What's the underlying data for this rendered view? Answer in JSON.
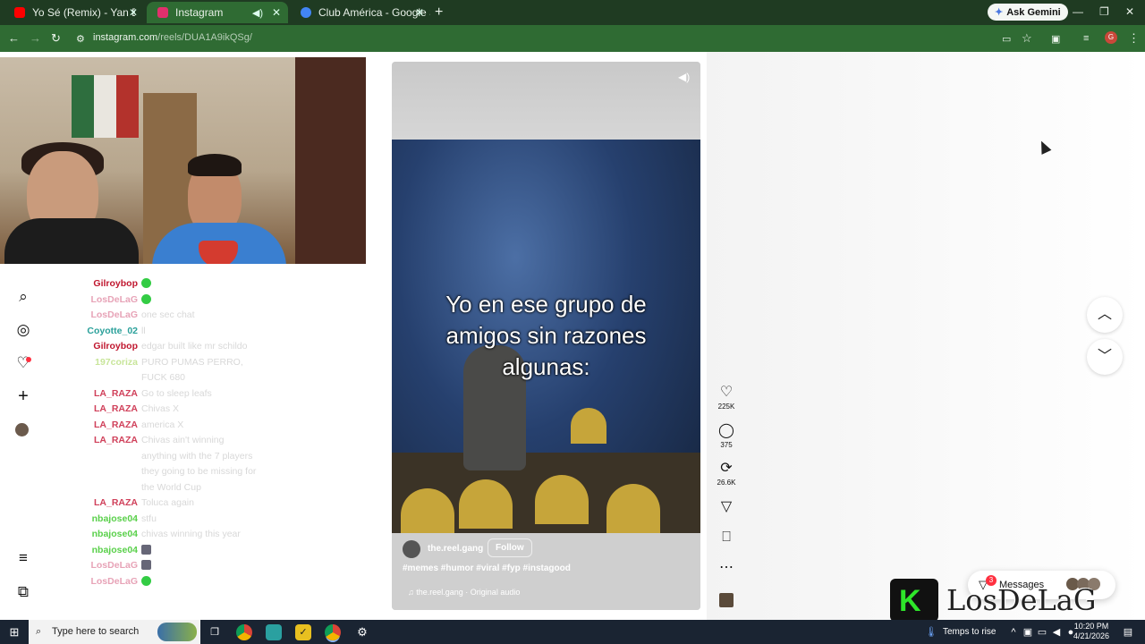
{
  "browser": {
    "tabs": [
      {
        "title": "Yo Sé (Remix) - Yan Block x Tor",
        "icon_color": "#ff0000",
        "active": false
      },
      {
        "title": "Instagram",
        "icon_color": "#e1306c",
        "active": true
      },
      {
        "title": "Club América - Google Search",
        "icon_color": "#4285f4",
        "active": false
      }
    ],
    "new_tab": "+",
    "ask_gemini": "Ask Gemini",
    "url_host": "instagram.com",
    "url_path": "/reels/DUA1A9ikQSg/",
    "profile_initial": "G",
    "colors": {
      "frame": "#1f3b22",
      "toolbar": "#2f6b33"
    }
  },
  "sidebar": {
    "icons": [
      "search-icon",
      "explore-icon",
      "heart-icon",
      "create-icon",
      "profile-icon",
      "menu-icon",
      "threads-icon"
    ]
  },
  "chat": {
    "messages": [
      {
        "user": "Gilroybop",
        "text": "",
        "color": "#c0172f",
        "emote": "green"
      },
      {
        "user": "LosDeLaG",
        "text": "",
        "color": "#e7a3b7",
        "emote": "green"
      },
      {
        "user": "LosDeLaG",
        "text": "one sec chat",
        "color": "#e7a3b7",
        "emote": ""
      },
      {
        "user": "Coyotte_02",
        "text": "ll",
        "color": "#2aa09a",
        "emote": ""
      },
      {
        "user": "Gilroybop",
        "text": "edgar built like mr schildo",
        "color": "#c0172f",
        "emote": ""
      },
      {
        "user": "197coriza",
        "text": "PURO PUMAS PERRO, FUCK 680",
        "color": "#c8e59a",
        "emote": ""
      },
      {
        "user": "LA_RAZA",
        "text": "Go to sleep leafs",
        "color": "#d0405a",
        "emote": ""
      },
      {
        "user": "LA_RAZA",
        "text": "Chivas X",
        "color": "#d0405a",
        "emote": ""
      },
      {
        "user": "LA_RAZA",
        "text": "america X",
        "color": "#d0405a",
        "emote": ""
      },
      {
        "user": "LA_RAZA",
        "text": "Chivas ain't winning anything with the 7 players they going to be missing for the World Cup",
        "color": "#d0405a",
        "emote": ""
      },
      {
        "user": "LA_RAZA",
        "text": "Toluca again",
        "color": "#d0405a",
        "emote": ""
      },
      {
        "user": "nbajose04",
        "text": "stfu",
        "color": "#59d04a",
        "emote": ""
      },
      {
        "user": "nbajose04",
        "text": "chivas winning this year",
        "color": "#59d04a",
        "emote": ""
      },
      {
        "user": "nbajose04",
        "text": "",
        "color": "#59d04a",
        "emote": "mask"
      },
      {
        "user": "LosDeLaG",
        "text": "",
        "color": "#e7a3b7",
        "emote": "mask"
      },
      {
        "user": "LosDeLaG",
        "text": "",
        "color": "#e7a3b7",
        "emote": "green"
      }
    ]
  },
  "reel": {
    "caption": "Yo en ese grupo de amigos sin razones algunas:",
    "username": "the.reel.gang",
    "follow_label": "Follow",
    "hashtags": "#memes #humor #viral #fyp #instagood",
    "audio": "the.reel.gang · Original audio"
  },
  "actions": {
    "likes": "225K",
    "comments": "375",
    "reposts": "26.6K"
  },
  "messages": {
    "label": "Messages",
    "badge": "3"
  },
  "logo": {
    "letter": "K",
    "text": "LosDeLaG"
  },
  "taskbar": {
    "search_placeholder": "Type here to search",
    "weather": "Temps to rise",
    "time": "10:20 PM",
    "date": "4/21/2026"
  }
}
